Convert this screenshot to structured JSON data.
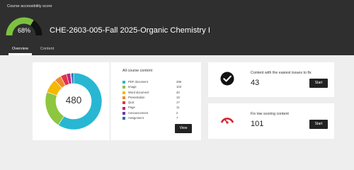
{
  "header": {
    "score_label": "Course accessibility score",
    "score_value": "68%",
    "score_fraction": 0.68,
    "score_color": "#7dc141",
    "course_title": "CHE-2603-005-Fall 2025-Organic Chemistry I"
  },
  "tabs": [
    {
      "label": "Overview",
      "active": true
    },
    {
      "label": "Content",
      "active": false
    }
  ],
  "content_summary": {
    "total": "480",
    "title": "All course content",
    "view_label": "View",
    "items": [
      {
        "label": "PDF document",
        "count": "288",
        "value": 288,
        "color": "#27b7d3"
      },
      {
        "label": "Image",
        "count": "103",
        "value": 103,
        "color": "#8dc63f"
      },
      {
        "label": "Word document",
        "count": "40",
        "value": 40,
        "color": "#f5b800"
      },
      {
        "label": "Presentation",
        "count": "19",
        "value": 19,
        "color": "#f08a2c"
      },
      {
        "label": "Quiz",
        "count": "17",
        "value": 17,
        "color": "#e0354b"
      },
      {
        "label": "Page",
        "count": "11",
        "value": 11,
        "color": "#c0247a"
      },
      {
        "label": "Announcement",
        "count": "2",
        "value": 2,
        "color": "#6a3d9a"
      },
      {
        "label": "Assignment",
        "count": "7",
        "value": 7,
        "color": "#2f6eb5"
      }
    ]
  },
  "issues_card": {
    "text": "Content with the easiest issues to fix",
    "count": "43",
    "button": "Start",
    "icon": "check-circle-icon"
  },
  "low_card": {
    "text": "Fix low scoring content",
    "count": "101",
    "button": "Start",
    "icon": "gauge-low-icon"
  }
}
